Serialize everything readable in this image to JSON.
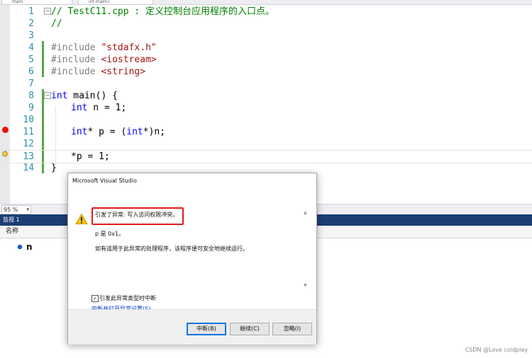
{
  "toolbar": {
    "scope_combo": "main",
    "member_combo": "int main()"
  },
  "editor": {
    "lines": [
      {
        "num": "1"
      },
      {
        "num": "2"
      },
      {
        "num": "3"
      },
      {
        "num": "4"
      },
      {
        "num": "5"
      },
      {
        "num": "6"
      },
      {
        "num": "7"
      },
      {
        "num": "8"
      },
      {
        "num": "9"
      },
      {
        "num": "10"
      },
      {
        "num": "11"
      },
      {
        "num": "12"
      },
      {
        "num": "13"
      },
      {
        "num": "14"
      }
    ],
    "code": {
      "l1": "// TestC11.cpp : 定义控制台应用程序的入口点。",
      "l2": "//",
      "l4_pre": "#include ",
      "l4_str": "\"stdafx.h\"",
      "l5_pre": "#include ",
      "l5_str": "<iostream>",
      "l6_pre": "#include ",
      "l6_str": "<string>",
      "l8_kw": "int",
      "l8_rest": " main() {",
      "l9_kw": "int",
      "l9_rest": " n = 1;",
      "l11_kw": "int",
      "l11_mid": "* p = (",
      "l11_kw2": "int",
      "l11_rest": "*)n;",
      "l13": "*p = 1;",
      "l14": "}"
    }
  },
  "zoom": {
    "value": "95 %",
    "dropdown_glyph": "▾"
  },
  "watch": {
    "title": "监视 1",
    "col_name": "名称",
    "items": [
      {
        "name": "n"
      }
    ]
  },
  "dialog": {
    "title": "Microsoft Visual Studio",
    "message": "引发了异常: 写入访问权限冲突。",
    "detail": "p 是 0x1。",
    "hint": "如有适用于此异常的处理程序，该程序便可安全地继续运行。",
    "checkbox_label": "引发此异常类型时中断",
    "checkbox_checked": "✓",
    "link": "中断并打开异常设置(S)",
    "buttons": {
      "break": "中断(B)",
      "continue": "继续(C)",
      "ignore": "忽略(I)"
    },
    "scroll_up": "▲",
    "scroll_down": "▼"
  },
  "watermark": "CSDN @Love coldplay",
  "colors": {
    "breakpoint": "#e51400",
    "watch_title_bg": "#1c3e73",
    "highlight": "#e01e1e"
  }
}
